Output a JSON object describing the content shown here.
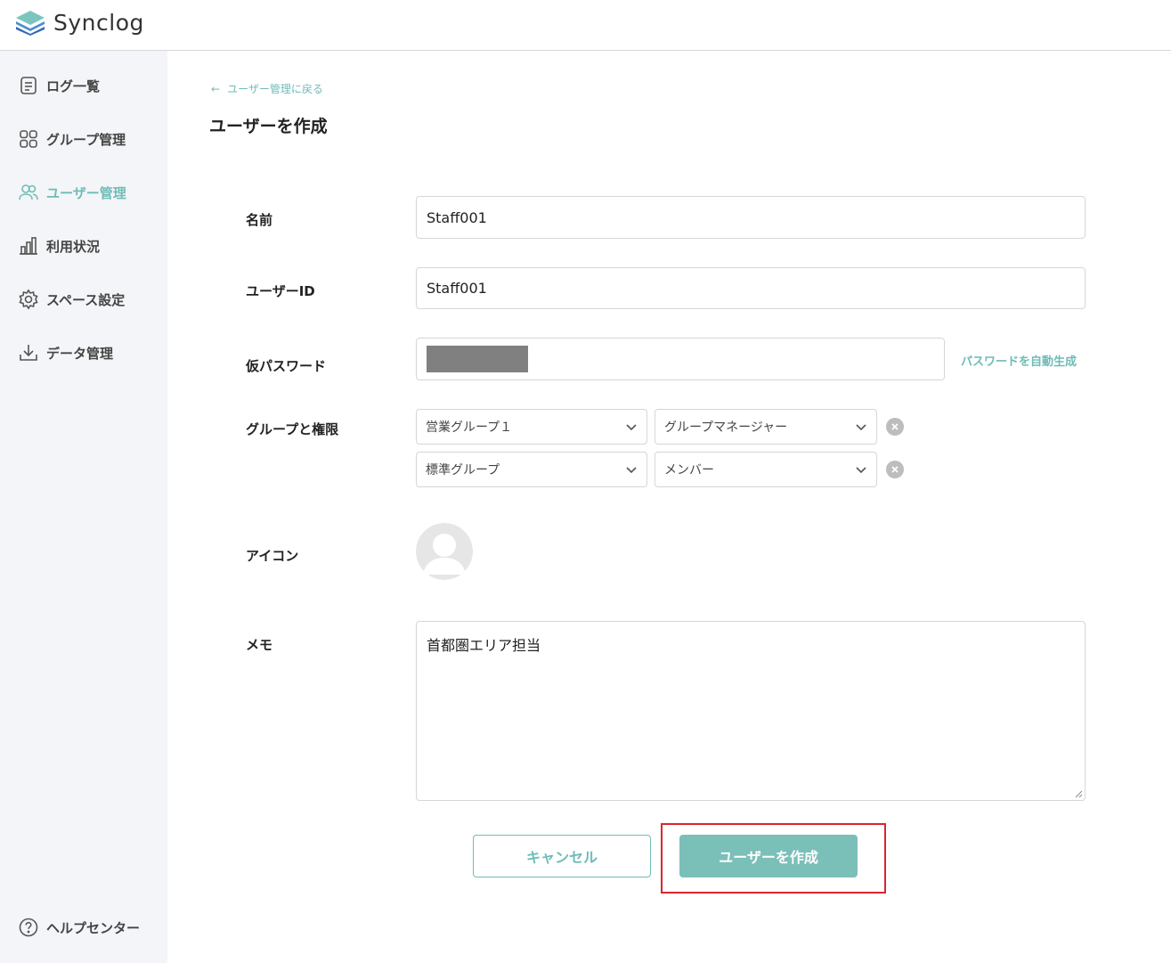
{
  "app": {
    "name": "Synclog"
  },
  "sidebar": {
    "items": [
      {
        "label": "ログ一覧",
        "icon": "document-icon"
      },
      {
        "label": "グループ管理",
        "icon": "grid-icon"
      },
      {
        "label": "ユーザー管理",
        "icon": "users-icon",
        "active": true
      },
      {
        "label": "利用状況",
        "icon": "bar-chart-icon"
      },
      {
        "label": "スペース設定",
        "icon": "gear-icon"
      },
      {
        "label": "データ管理",
        "icon": "download-icon"
      }
    ],
    "help": {
      "label": "ヘルプセンター",
      "icon": "question-icon"
    }
  },
  "main": {
    "back_link": "ユーザー管理に戻る",
    "title": "ユーザーを作成",
    "form": {
      "name": {
        "label": "名前",
        "value": "Staff001"
      },
      "user_id": {
        "label": "ユーザーID",
        "value": "Staff001"
      },
      "temp_password": {
        "label": "仮パスワード",
        "generate_link": "パスワードを自動生成"
      },
      "groups": {
        "label": "グループと権限",
        "rows": [
          {
            "group": "営業グループ１",
            "role": "グループマネージャー"
          },
          {
            "group": "標準グループ",
            "role": "メンバー"
          }
        ]
      },
      "icon": {
        "label": "アイコン"
      },
      "memo": {
        "label": "メモ",
        "value": "首都圏エリア担当"
      }
    },
    "buttons": {
      "cancel": "キャンセル",
      "create": "ユーザーを作成"
    }
  },
  "colors": {
    "accent": "#6fbcb7",
    "button_primary": "#7bbfb9",
    "highlight": "#d9262d",
    "sidebar_bg": "#f4f5f8"
  }
}
